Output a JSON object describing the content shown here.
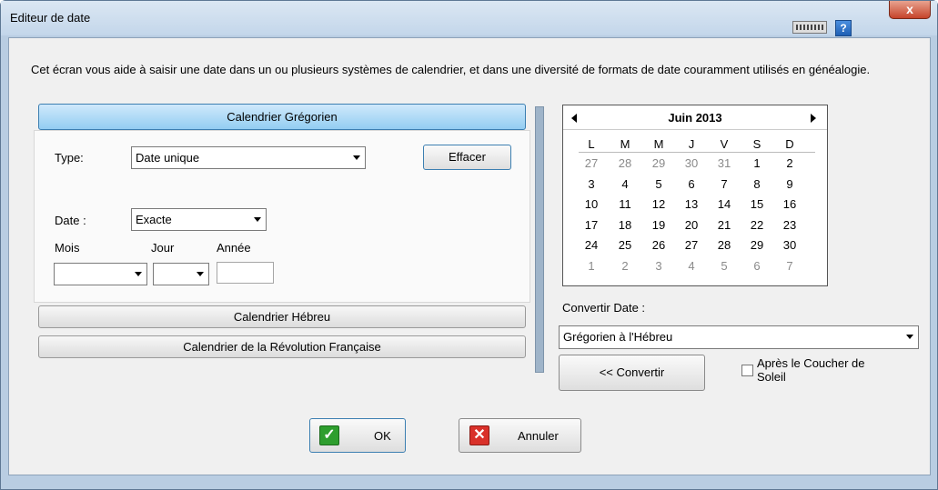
{
  "window": {
    "title": "Editeur de date",
    "close_glyph": "x",
    "help_glyph": "?"
  },
  "description": "Cet écran vous aide à saisir une date dans un ou plusieurs systèmes de calendrier, et dans une diversité de formats de date couramment utilisés en généalogie.",
  "tabs": {
    "gregorian": "Calendrier Grégorien",
    "hebrew": "Calendrier Hébreu",
    "french_revolution": "Calendrier de la Révolution Française"
  },
  "form": {
    "type_label": "Type:",
    "type_value": "Date unique",
    "clear_button": "Effacer",
    "date_label": "Date :",
    "date_value": "Exacte",
    "month_label": "Mois",
    "day_label": "Jour",
    "year_label": "Année",
    "month_value": "",
    "day_value": "",
    "year_value": ""
  },
  "calendar": {
    "title": "Juin 2013",
    "weekdays": [
      "L",
      "M",
      "M",
      "J",
      "V",
      "S",
      "D"
    ],
    "weeks": [
      [
        {
          "d": "27",
          "o": true
        },
        {
          "d": "28",
          "o": true
        },
        {
          "d": "29",
          "o": true
        },
        {
          "d": "30",
          "o": true
        },
        {
          "d": "31",
          "o": true
        },
        {
          "d": "1",
          "o": false
        },
        {
          "d": "2",
          "o": false
        }
      ],
      [
        {
          "d": "3",
          "o": false
        },
        {
          "d": "4",
          "o": false
        },
        {
          "d": "5",
          "o": false
        },
        {
          "d": "6",
          "o": false
        },
        {
          "d": "7",
          "o": false
        },
        {
          "d": "8",
          "o": false
        },
        {
          "d": "9",
          "o": false
        }
      ],
      [
        {
          "d": "10",
          "o": false
        },
        {
          "d": "11",
          "o": false
        },
        {
          "d": "12",
          "o": false
        },
        {
          "d": "13",
          "o": false
        },
        {
          "d": "14",
          "o": false
        },
        {
          "d": "15",
          "o": false
        },
        {
          "d": "16",
          "o": false
        }
      ],
      [
        {
          "d": "17",
          "o": false
        },
        {
          "d": "18",
          "o": false
        },
        {
          "d": "19",
          "o": false
        },
        {
          "d": "20",
          "o": false
        },
        {
          "d": "21",
          "o": false
        },
        {
          "d": "22",
          "o": false
        },
        {
          "d": "23",
          "o": false
        }
      ],
      [
        {
          "d": "24",
          "o": false
        },
        {
          "d": "25",
          "o": false
        },
        {
          "d": "26",
          "o": false
        },
        {
          "d": "27",
          "o": false
        },
        {
          "d": "28",
          "o": false
        },
        {
          "d": "29",
          "o": false
        },
        {
          "d": "30",
          "o": false
        }
      ],
      [
        {
          "d": "1",
          "o": true
        },
        {
          "d": "2",
          "o": true
        },
        {
          "d": "3",
          "o": true
        },
        {
          "d": "4",
          "o": true
        },
        {
          "d": "5",
          "o": true
        },
        {
          "d": "6",
          "o": true
        },
        {
          "d": "7",
          "o": true
        }
      ]
    ]
  },
  "convert": {
    "label": "Convertir Date :",
    "value": "Grégorien à l'Hébreu",
    "button": "<< Convertir",
    "sunset_line1": "Après le Coucher de",
    "sunset_line2": "Soleil",
    "sunset_checked": false
  },
  "footer": {
    "ok": "OK",
    "cancel": "Annuler"
  },
  "colors": {
    "ok_green": "#2e9e2e",
    "cancel_red": "#d9312a",
    "active_tab": "#93cdf2"
  },
  "icons": {
    "ok": "check-icon",
    "cancel": "x-icon",
    "keyboard": "keyboard-icon",
    "help": "help-icon"
  }
}
